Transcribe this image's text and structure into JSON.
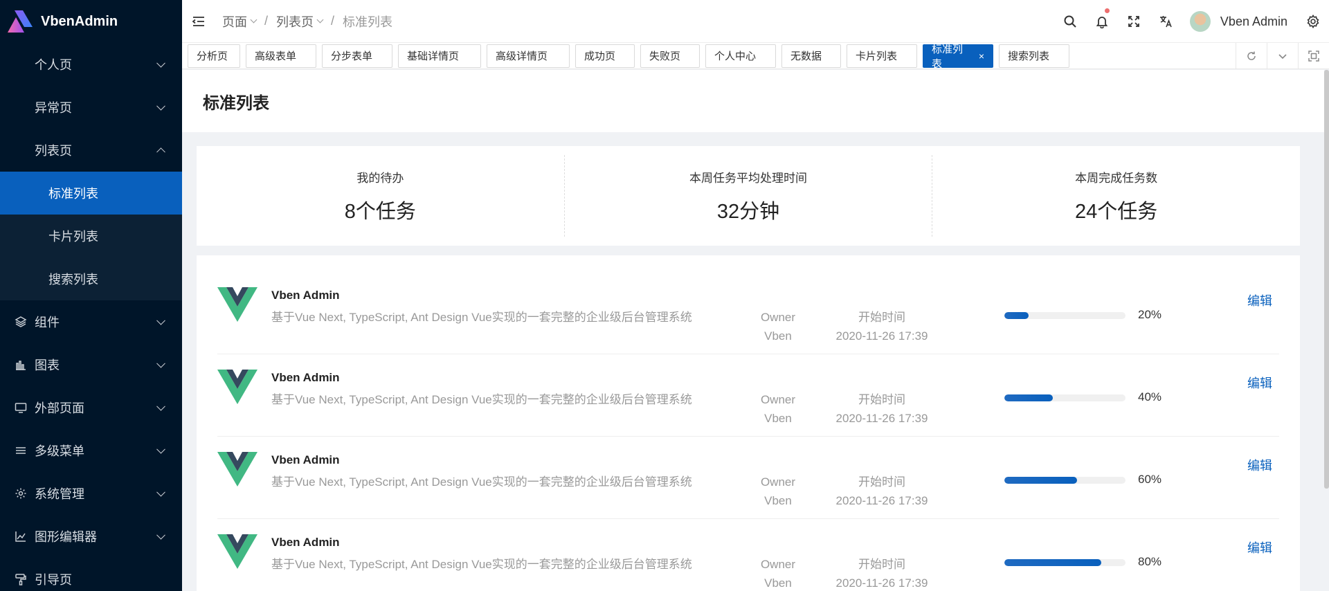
{
  "app": {
    "title": "VbenAdmin"
  },
  "sidebar": {
    "items": [
      {
        "label": "个人页",
        "level": 1,
        "chevron": "down"
      },
      {
        "label": "异常页",
        "level": 1,
        "chevron": "down"
      },
      {
        "label": "列表页",
        "level": 1,
        "chevron": "up"
      },
      {
        "label": "标准列表",
        "level": 2,
        "active": true
      },
      {
        "label": "卡片列表",
        "level": 2
      },
      {
        "label": "搜索列表",
        "level": 2
      },
      {
        "label": "组件",
        "level": 0,
        "icon": "layers-icon",
        "chevron": "down"
      },
      {
        "label": "图表",
        "level": 0,
        "icon": "bar-chart-icon",
        "chevron": "down"
      },
      {
        "label": "外部页面",
        "level": 0,
        "icon": "monitor-icon",
        "chevron": "down"
      },
      {
        "label": "多级菜单",
        "level": 0,
        "icon": "menu-icon",
        "chevron": "down"
      },
      {
        "label": "系统管理",
        "level": 0,
        "icon": "gear-icon",
        "chevron": "down"
      },
      {
        "label": "图形编辑器",
        "level": 0,
        "icon": "chart-edit-icon",
        "chevron": "down"
      },
      {
        "label": "引导页",
        "level": 0,
        "icon": "paint-roller-icon"
      }
    ]
  },
  "header": {
    "breadcrumb": [
      {
        "label": "页面",
        "dropdown": true
      },
      {
        "label": "列表页",
        "dropdown": true
      },
      {
        "label": "标准列表",
        "dropdown": false
      }
    ],
    "user_name": "Vben Admin"
  },
  "tabs": [
    {
      "label": "分析页"
    },
    {
      "label": "高级表单"
    },
    {
      "label": "分步表单"
    },
    {
      "label": "基础详情页"
    },
    {
      "label": "高级详情页"
    },
    {
      "label": "成功页"
    },
    {
      "label": "失败页"
    },
    {
      "label": "个人中心"
    },
    {
      "label": "无数据"
    },
    {
      "label": "卡片列表"
    },
    {
      "label": "标准列表",
      "active": true,
      "close": "×"
    },
    {
      "label": "搜索列表"
    }
  ],
  "page": {
    "title": "标准列表"
  },
  "stats": [
    {
      "title": "我的待办",
      "value": "8个任务"
    },
    {
      "title": "本周任务平均处理时间",
      "value": "32分钟"
    },
    {
      "title": "本周完成任务数",
      "value": "24个任务"
    }
  ],
  "list": {
    "items": [
      {
        "title": "Vben Admin",
        "desc": "基于Vue Next, TypeScript, Ant Design Vue实现的一套完整的企业级后台管理系统",
        "owner_label": "Owner",
        "owner": "Vben",
        "time_label": "开始时间",
        "time": "2020-11-26 17:39",
        "percent": 20,
        "percent_text": "20%",
        "action": "编辑"
      },
      {
        "title": "Vben Admin",
        "desc": "基于Vue Next, TypeScript, Ant Design Vue实现的一套完整的企业级后台管理系统",
        "owner_label": "Owner",
        "owner": "Vben",
        "time_label": "开始时间",
        "time": "2020-11-26 17:39",
        "percent": 40,
        "percent_text": "40%",
        "action": "编辑"
      },
      {
        "title": "Vben Admin",
        "desc": "基于Vue Next, TypeScript, Ant Design Vue实现的一套完整的企业级后台管理系统",
        "owner_label": "Owner",
        "owner": "Vben",
        "time_label": "开始时间",
        "time": "2020-11-26 17:39",
        "percent": 60,
        "percent_text": "60%",
        "action": "编辑"
      },
      {
        "title": "Vben Admin",
        "desc": "基于Vue Next, TypeScript, Ant Design Vue实现的一套完整的企业级后台管理系统",
        "owner_label": "Owner",
        "owner": "Vben",
        "time_label": "开始时间",
        "time": "2020-11-26 17:39",
        "percent": 80,
        "percent_text": "80%",
        "action": "编辑"
      }
    ]
  },
  "colors": {
    "sidebar_bg": "#001529",
    "accent": "#0960bd",
    "vue_green": "#41b883",
    "vue_dark": "#35495e"
  }
}
